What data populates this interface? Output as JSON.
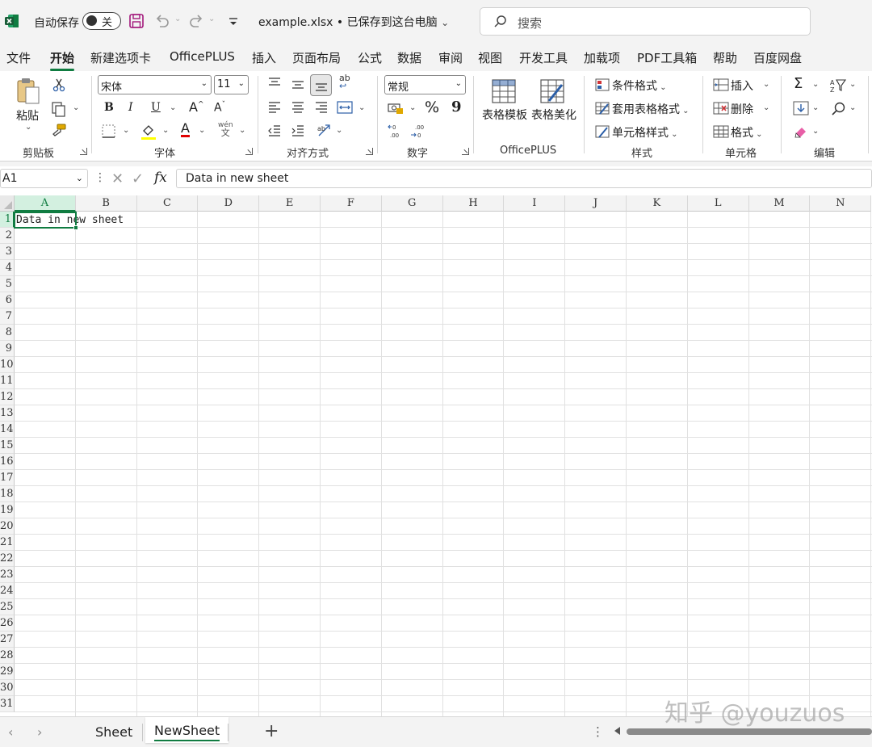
{
  "titlebar": {
    "autosave_label": "自动保存",
    "autosave_state": "关",
    "document_title": "example.xlsx • 已保存到这台电脑",
    "search_placeholder": "搜索"
  },
  "menu": {
    "tabs": [
      "文件",
      "开始",
      "新建选项卡",
      "OfficePLUS",
      "插入",
      "页面布局",
      "公式",
      "数据",
      "审阅",
      "视图",
      "开发工具",
      "加载项",
      "PDF工具箱",
      "帮助",
      "百度网盘"
    ],
    "active_tab": "开始"
  },
  "ribbon": {
    "clipboard": {
      "paste_label": "粘贴",
      "group_label": "剪贴板"
    },
    "font": {
      "font_name": "宋体",
      "font_size": "11",
      "bold": "B",
      "italic": "I",
      "underline": "U",
      "grow": "A",
      "shrink": "A",
      "phonetic": "wén",
      "phonetic_char": "文",
      "font_color_letter": "A",
      "group_label": "字体"
    },
    "alignment": {
      "group_label": "对齐方式",
      "wrap_icon_text": "ab"
    },
    "number": {
      "format": "常规",
      "percent": "%",
      "comma": "9",
      "group_label": "数字"
    },
    "officeplus": {
      "template_label": "表格模板",
      "beautify_label": "表格美化",
      "group_label": "OfficePLUS"
    },
    "styles": {
      "conditional_format": "条件格式",
      "table_format": "套用表格格式",
      "cell_styles": "单元格样式",
      "group_label": "样式"
    },
    "cells": {
      "insert": "插入",
      "delete": "删除",
      "format": "格式",
      "group_label": "单元格"
    },
    "editing": {
      "sum_symbol": "Σ",
      "group_label": "编辑"
    }
  },
  "formula_bar": {
    "name_box": "A1",
    "fx_label": "fx",
    "content": "Data in new sheet"
  },
  "grid": {
    "columns": [
      "A",
      "B",
      "C",
      "D",
      "E",
      "F",
      "G",
      "H",
      "I",
      "J",
      "K",
      "L",
      "M",
      "N"
    ],
    "rows": [
      "1",
      "2",
      "3",
      "4",
      "5",
      "6",
      "7",
      "8",
      "9",
      "10",
      "11",
      "12",
      "13",
      "14",
      "15",
      "16",
      "17",
      "18",
      "19",
      "20",
      "21",
      "22",
      "23",
      "24",
      "25",
      "26",
      "27",
      "28",
      "29",
      "30",
      "31"
    ],
    "active_cell": "A1",
    "a1_value": "Data in new sheet"
  },
  "sheets": {
    "tabs": [
      "Sheet",
      "NewSheet"
    ],
    "active": "NewSheet",
    "add_label": "+"
  },
  "watermark": "知乎 @youzuos",
  "colors": {
    "accent": "#107c41",
    "chrome": "#f3f3f3"
  }
}
